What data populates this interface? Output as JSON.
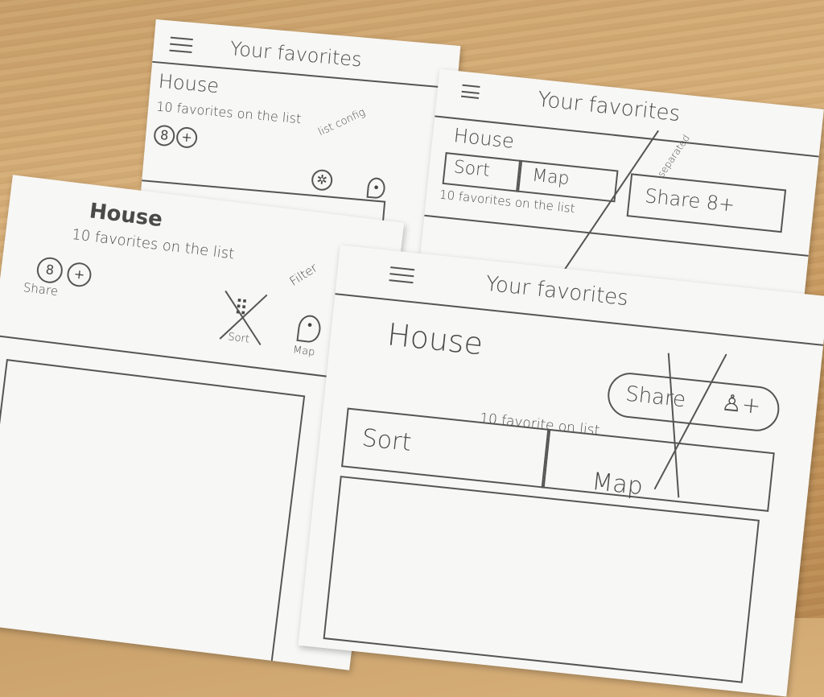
{
  "cards": [
    {
      "title": "Your favorites",
      "name": "House",
      "count": "10 favorites on the list",
      "note": "list config"
    },
    {
      "title": "Your favorites",
      "name": "House",
      "sort": "Sort",
      "map": "Map",
      "share": "Share 8+",
      "count": "10 favorites on the list",
      "note": "separated"
    },
    {
      "name": "House",
      "count": "10 favorites on the list",
      "share": "Share",
      "note": "Filter",
      "sort": "Sort",
      "map": "Map"
    },
    {
      "title": "Your favorites",
      "name": "House",
      "share": "Share",
      "count": "10 favorite on list",
      "sort": "Sort",
      "map": "Map"
    }
  ]
}
